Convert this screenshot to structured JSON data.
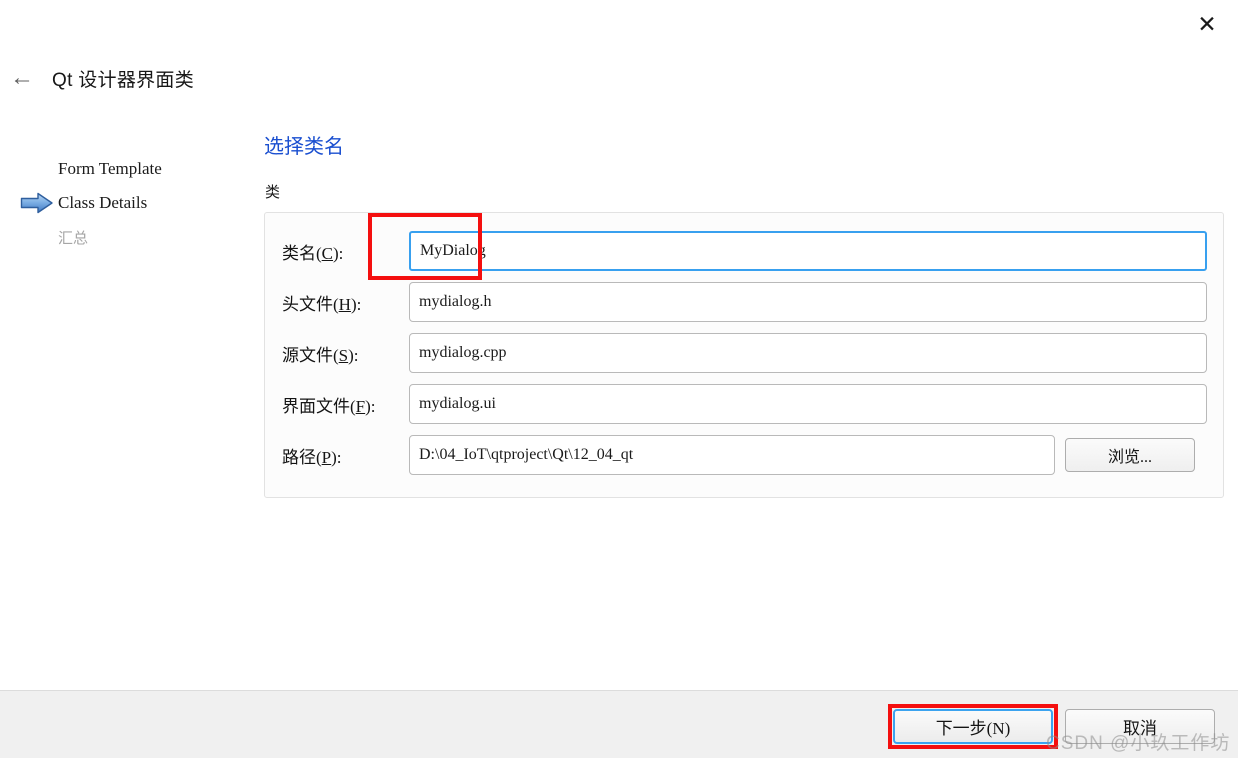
{
  "window": {
    "title": "Qt 设计器界面类",
    "close_label": "✕",
    "back_label": "←"
  },
  "nav": {
    "items": [
      {
        "label": "Form Template",
        "marker": "none",
        "state": "done"
      },
      {
        "label": "Class Details",
        "marker": "blue-arrow",
        "state": "current"
      },
      {
        "label": "汇总",
        "marker": "none",
        "state": "upcoming"
      }
    ]
  },
  "main": {
    "heading": "选择类名",
    "group_label": "类",
    "fields": [
      {
        "label_prefix": "类名(",
        "mnemonic": "C",
        "label_suffix": "):",
        "value": "MyDialog",
        "focused": true,
        "annotated": true
      },
      {
        "label_prefix": "头文件(",
        "mnemonic": "H",
        "label_suffix": "):",
        "value": "mydialog.h",
        "focused": false,
        "annotated": false
      },
      {
        "label_prefix": "源文件(",
        "mnemonic": "S",
        "label_suffix": "):",
        "value": "mydialog.cpp",
        "focused": false,
        "annotated": false
      },
      {
        "label_prefix": "界面文件(",
        "mnemonic": "F",
        "label_suffix": "):",
        "value": "mydialog.ui",
        "focused": false,
        "annotated": false
      },
      {
        "label_prefix": "路径(",
        "mnemonic": "P",
        "label_suffix": "):",
        "value": "D:\\04_IoT\\qtproject\\Qt\\12_04_qt",
        "focused": false,
        "annotated": false
      }
    ],
    "browse_button": "浏览..."
  },
  "footer": {
    "next_button": "下一步(N)",
    "cancel_button": "取消"
  },
  "watermark": "CSDN @小玖工作坊",
  "colors": {
    "heading_blue": "#1a4fd0",
    "focus_blue": "#38a0ef",
    "annotation_red": "#f40f0f",
    "footer_bg": "#f0f0f0",
    "group_bg": "#fcfcfc"
  }
}
